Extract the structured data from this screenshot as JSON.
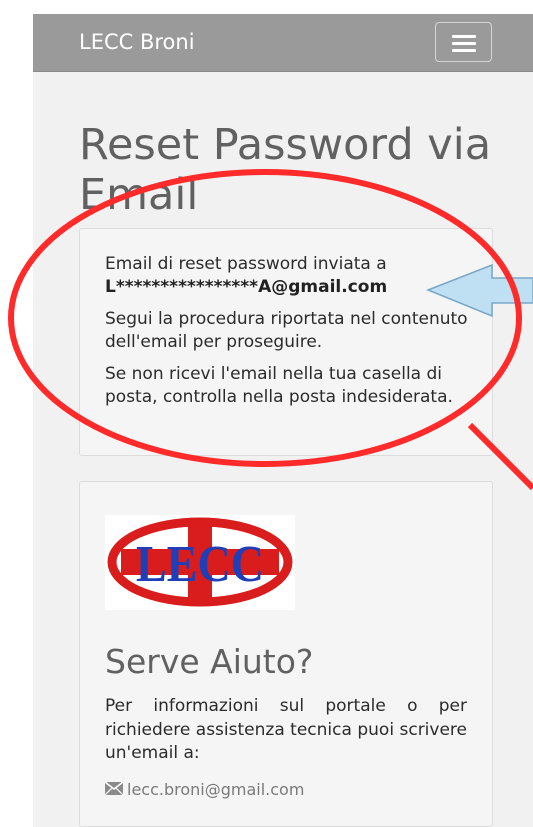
{
  "navbar": {
    "brand": "LECC Broni"
  },
  "page": {
    "title": "Reset Password via Email"
  },
  "reset_card": {
    "line1_prefix": "Email di reset password inviata a ",
    "masked_email": "L****************A@gmail.com",
    "paragraph2": "Segui la procedura riportata nel contenuto dell'email per proseguire.",
    "paragraph3": "Se non ricevi l'email nella tua casella di posta, controlla nella posta indesiderata."
  },
  "help_card": {
    "logo_text": "LECC",
    "title": "Serve Aiuto?",
    "text": "Per informazioni sul portale o per richiedere assistenza tecnica puoi scrivere un'email a:",
    "email": "lecc.broni@gmail.com",
    "email_icon": "envelope-icon"
  },
  "annotations": {
    "highlight_color": "#ff2a2a",
    "arrow_color": "#bfe0f2"
  }
}
